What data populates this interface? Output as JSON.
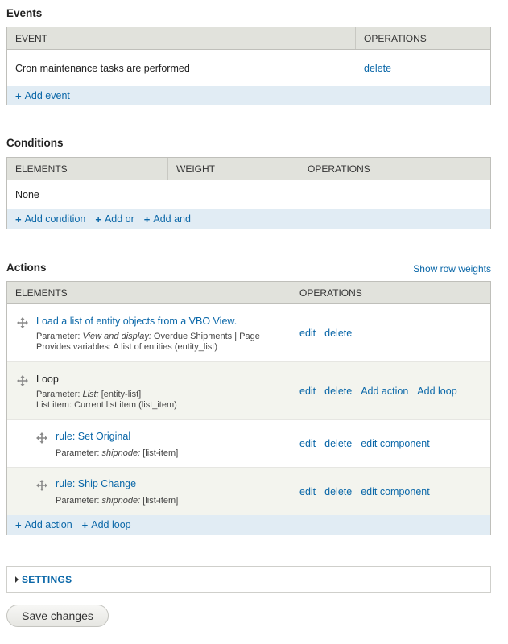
{
  "events": {
    "title": "Events",
    "columns": [
      "EVENT",
      "OPERATIONS"
    ],
    "rows": [
      {
        "event": "Cron maintenance tasks are performed",
        "op_delete": "delete"
      }
    ],
    "add_event": "Add event"
  },
  "conditions": {
    "title": "Conditions",
    "columns": [
      "ELEMENTS",
      "WEIGHT",
      "OPERATIONS"
    ],
    "empty": "None",
    "add_condition": "Add condition",
    "add_or": "Add or",
    "add_and": "Add and"
  },
  "actions": {
    "title": "Actions",
    "show_row_weights": "Show row weights",
    "columns": [
      "ELEMENTS",
      "OPERATIONS"
    ],
    "rows": [
      {
        "title": "Load a list of entity objects from a VBO View.",
        "line1_prefix": "Parameter: ",
        "line1_italic": "View and display:",
        "line1_rest": " Overdue Shipments | Page",
        "line2": "Provides variables: A list of entities (entity_list)",
        "ops": [
          "edit",
          "delete"
        ]
      },
      {
        "title": "Loop",
        "line1_prefix": "Parameter: ",
        "line1_italic": "List:",
        "line1_rest": " [entity-list]",
        "line2": "List item: Current list item (list_item)",
        "ops": [
          "edit",
          "delete",
          "Add action",
          "Add loop"
        ]
      },
      {
        "title": "rule: Set Original",
        "line1_prefix": "Parameter: ",
        "line1_italic": "shipnode:",
        "line1_rest": " [list-item]",
        "ops": [
          "edit",
          "delete",
          "edit component"
        ]
      },
      {
        "title": "rule: Ship Change",
        "line1_prefix": "Parameter: ",
        "line1_italic": "shipnode:",
        "line1_rest": " [list-item]",
        "ops": [
          "edit",
          "delete",
          "edit component"
        ]
      }
    ],
    "add_action": "Add action",
    "add_loop": "Add loop"
  },
  "settings": {
    "label": "SETTINGS"
  },
  "save_label": "Save changes",
  "icons": {
    "drag": "drag-handle-icon",
    "add": "plus-icon",
    "expand": "triangle-right-icon"
  },
  "colors": {
    "link": "#0a67a8",
    "header_bg": "#e1e2dc",
    "footer_bg": "#e1ecf4",
    "alt_row": "#f3f4ee"
  }
}
